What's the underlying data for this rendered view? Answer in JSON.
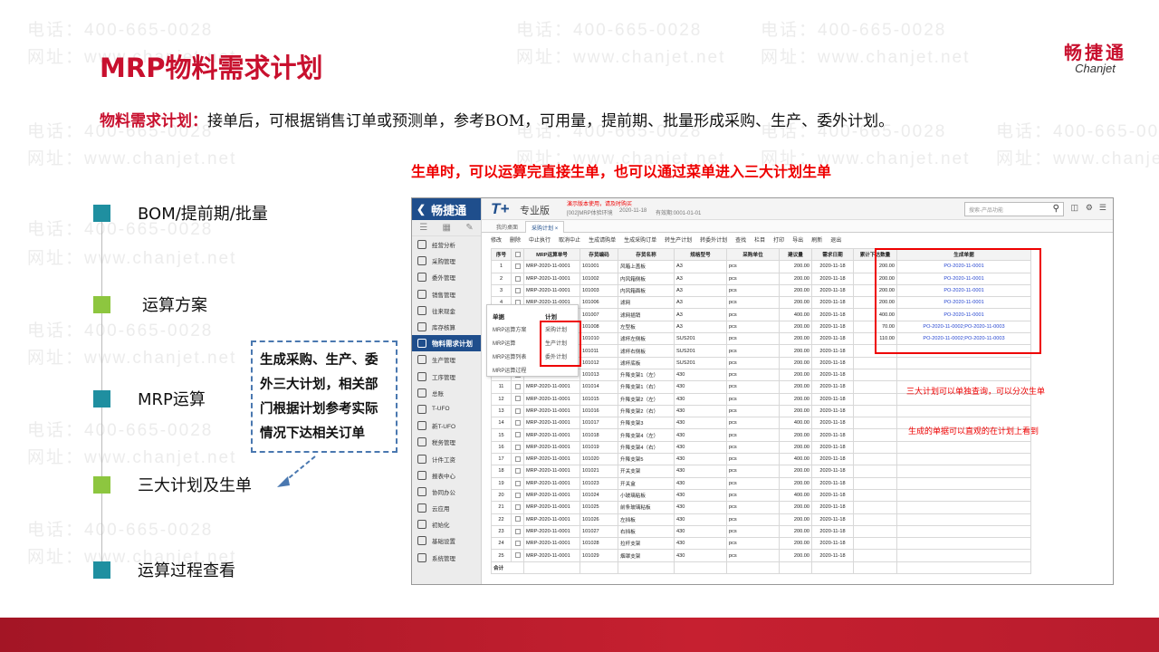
{
  "watermark": {
    "phone": "电话：400-665-0028",
    "site": "网址：www.chanjet.net"
  },
  "brand": {
    "name_cn": "畅捷通",
    "name_en": "Chanjet"
  },
  "page_title": "MRP物料需求计划",
  "intro": {
    "keyword": "物料需求计划：",
    "text": "接单后，可根据销售订单或预测单，参考BOM，可用量，提前期、批量形成采购、生产、委外计划。"
  },
  "red_note": "生单时，可以运算完直接生单，也可以通过菜单进入三大计划生单",
  "steps": [
    {
      "label": "BOM/提前期/批量",
      "color": "#1f8fa0"
    },
    {
      "label": "运算方案",
      "color": "#8dc63f"
    },
    {
      "label": "MRP运算",
      "color": "#1f8fa0"
    },
    {
      "label": "三大计划及生单",
      "color": "#8dc63f"
    },
    {
      "label": "运算过程查看",
      "color": "#1f8fa0"
    }
  ],
  "callout": {
    "lines": [
      "生成采购、生产、委",
      "外三大计划，相关部",
      "门根据计划参考实际",
      "情况下达相关订单"
    ]
  },
  "app": {
    "logo": "畅捷通",
    "logo_t": "T+",
    "edition": "专业版",
    "warning": "演示版本使用，请及时购买",
    "context": "[002]MRP体验环境",
    "date": "2020-11-18",
    "account_period": "有效期:0001-01-01",
    "search_placeholder": "搜索-产品功能",
    "sidebar": [
      "经营分析",
      "采购管理",
      "委外管理",
      "销售管理",
      "往来现金",
      "库存核算",
      "物料需求计划",
      "生产管理",
      "工序管理",
      "总账",
      "T-UFO",
      "新T-UFO",
      "税务管理",
      "计件工资",
      "报表中心",
      "协同办公",
      "云应用",
      "初始化",
      "基础设置",
      "系统管理"
    ],
    "active_sidebar_index": 6,
    "tabs": {
      "home": "我的桌面",
      "active": "采购计划"
    },
    "toolbar": [
      "修改",
      "删除",
      "中止执行",
      "取消中止",
      "生成请购单",
      "生成采购订单",
      "转生产计划",
      "转委外计划",
      "查找",
      "栏目",
      "打印",
      "导出",
      "刷新",
      "退出"
    ],
    "columns": [
      "序号",
      "",
      "MRP运算单号",
      "存货编码",
      "存货名称",
      "规格型号",
      "采购单位",
      "建议量",
      "需求日期",
      "累计下达数量",
      "生成单据"
    ],
    "rows": [
      [
        "1",
        "MRP-2020-11-0001",
        "101001",
        "风箱上盖板",
        "A3",
        "pcs",
        "200.00",
        "2020-11-18",
        "200.00",
        "PO-2020-11-0001"
      ],
      [
        "2",
        "MRP-2020-11-0001",
        "101002",
        "内风箱侧板",
        "A3",
        "pcs",
        "200.00",
        "2020-11-18",
        "200.00",
        "PO-2020-11-0001"
      ],
      [
        "3",
        "MRP-2020-11-0001",
        "101003",
        "内风箱面板",
        "A3",
        "pcs",
        "200.00",
        "2020-11-18",
        "200.00",
        "PO-2020-11-0001"
      ],
      [
        "4",
        "MRP-2020-11-0001",
        "101006",
        "滤网",
        "A3",
        "pcs",
        "200.00",
        "2020-11-18",
        "200.00",
        "PO-2020-11-0001"
      ],
      [
        "5",
        "MRP-2020-11-0001",
        "101007",
        "滤网插销",
        "A3",
        "pcs",
        "400.00",
        "2020-11-18",
        "400.00",
        "PO-2020-11-0001"
      ],
      [
        "6",
        "MRP-2020-11-0001",
        "101008",
        "左型板",
        "A3",
        "pcs",
        "200.00",
        "2020-11-18",
        "70.00",
        "PO-2020-11-0002;PO-2020-11-0003"
      ],
      [
        "7",
        "MRP-2020-11-0001",
        "101010",
        "滤杯左侧板",
        "SUS201",
        "pcs",
        "200.00",
        "2020-11-18",
        "110.00",
        "PO-2020-11-0002;PO-2020-11-0003"
      ],
      [
        "8",
        "MRP-2020-11-0001",
        "101011",
        "滤杯右侧板",
        "SUS201",
        "pcs",
        "200.00",
        "2020-11-18",
        "",
        ""
      ],
      [
        "9",
        "MRP-2020-11-0001",
        "101012",
        "滤杯底板",
        "SUS201",
        "pcs",
        "200.00",
        "2020-11-18",
        "",
        ""
      ],
      [
        "10",
        "MRP-2020-11-0001",
        "101013",
        "升降支架1（左）",
        "430",
        "pcs",
        "200.00",
        "2020-11-18",
        "",
        ""
      ],
      [
        "11",
        "MRP-2020-11-0001",
        "101014",
        "升降支架1（右）",
        "430",
        "pcs",
        "200.00",
        "2020-11-18",
        "",
        ""
      ],
      [
        "12",
        "MRP-2020-11-0001",
        "101015",
        "升降支架2（左）",
        "430",
        "pcs",
        "200.00",
        "2020-11-18",
        "",
        ""
      ],
      [
        "13",
        "MRP-2020-11-0001",
        "101016",
        "升降支架2（右）",
        "430",
        "pcs",
        "200.00",
        "2020-11-18",
        "",
        ""
      ],
      [
        "14",
        "MRP-2020-11-0001",
        "101017",
        "升降支架3",
        "430",
        "pcs",
        "400.00",
        "2020-11-18",
        "",
        ""
      ],
      [
        "15",
        "MRP-2020-11-0001",
        "101018",
        "升降支架4（左）",
        "430",
        "pcs",
        "200.00",
        "2020-11-18",
        "",
        ""
      ],
      [
        "16",
        "MRP-2020-11-0001",
        "101019",
        "升降支架4（右）",
        "430",
        "pcs",
        "200.00",
        "2020-11-18",
        "",
        ""
      ],
      [
        "17",
        "MRP-2020-11-0001",
        "101020",
        "升降支架5",
        "430",
        "pcs",
        "400.00",
        "2020-11-18",
        "",
        ""
      ],
      [
        "18",
        "MRP-2020-11-0001",
        "101021",
        "开关支架",
        "430",
        "pcs",
        "200.00",
        "2020-11-18",
        "",
        ""
      ],
      [
        "19",
        "MRP-2020-11-0001",
        "101023",
        "开关盒",
        "430",
        "pcs",
        "200.00",
        "2020-11-18",
        "",
        ""
      ],
      [
        "20",
        "MRP-2020-11-0001",
        "101024",
        "小玻璃粘板",
        "430",
        "pcs",
        "400.00",
        "2020-11-18",
        "",
        ""
      ],
      [
        "21",
        "MRP-2020-11-0001",
        "101025",
        "前条玻璃粘板",
        "430",
        "pcs",
        "200.00",
        "2020-11-18",
        "",
        ""
      ],
      [
        "22",
        "MRP-2020-11-0001",
        "101026",
        "左挡板",
        "430",
        "pcs",
        "200.00",
        "2020-11-18",
        "",
        ""
      ],
      [
        "23",
        "MRP-2020-11-0001",
        "101027",
        "右挡板",
        "430",
        "pcs",
        "200.00",
        "2020-11-18",
        "",
        ""
      ],
      [
        "24",
        "MRP-2020-11-0001",
        "101028",
        "拉杆支架",
        "430",
        "pcs",
        "200.00",
        "2020-11-18",
        "",
        ""
      ],
      [
        "25",
        "MRP-2020-11-0001",
        "101029",
        "烟罩支架",
        "430",
        "pcs",
        "200.00",
        "2020-11-18",
        "",
        ""
      ]
    ],
    "total_label": "合计",
    "popup": {
      "col1_header": "单据",
      "col2_header": "计划",
      "col1": [
        "MRP运算方案",
        "MRP运算",
        "MRP运算列表",
        "MRP运算过程"
      ],
      "col2": [
        "采购计划",
        "生产计划",
        "委外计划"
      ]
    },
    "notes": [
      "三大计划可以单独查询，可以分次生单",
      "生成的单据可以直观的在计划上看到"
    ]
  }
}
